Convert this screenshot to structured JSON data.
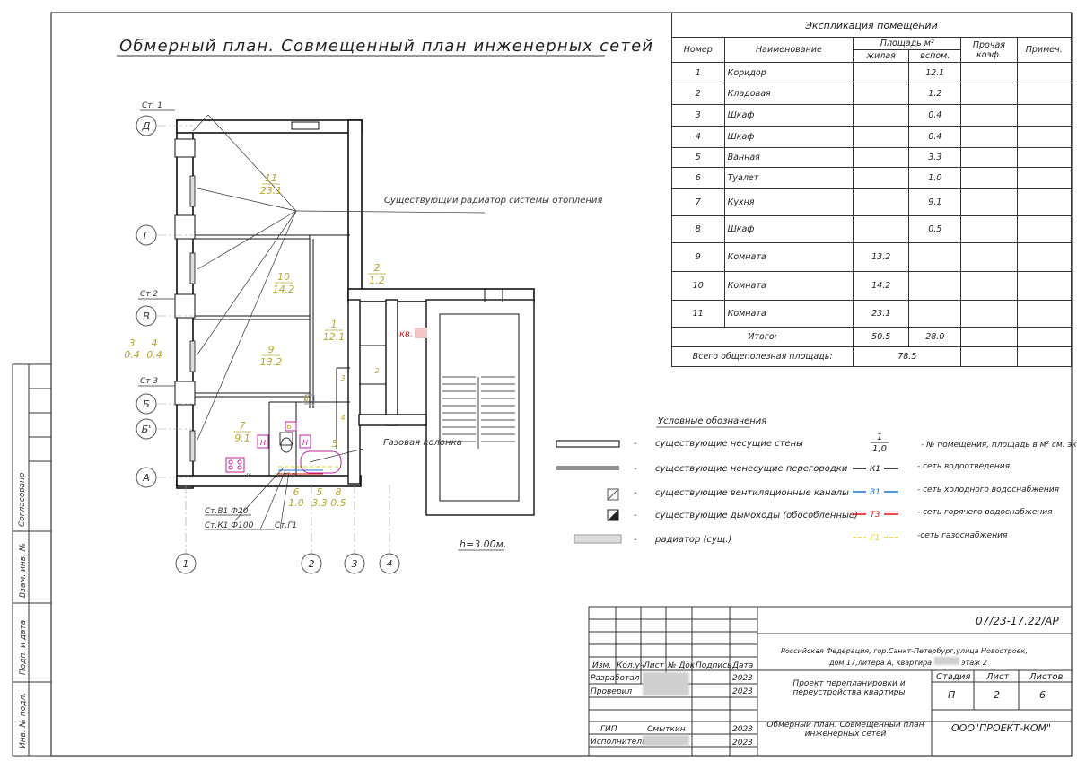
{
  "title": "Обмерный план. Совмещенный план инженерных сетей",
  "height_note": "h=3.00м.",
  "axes": {
    "letters": [
      "Д",
      "Г",
      "В",
      "Б",
      "Б'",
      "А"
    ],
    "numbers": [
      "1",
      "2",
      "3",
      "4"
    ]
  },
  "risers": [
    "Ст. 1",
    "Ст 2",
    "Ст 3"
  ],
  "riser_labels": [
    "Ст.В1 Ф20",
    "Ст.К1 Ф100",
    "Ст.Г1"
  ],
  "room_labels": [
    {
      "no": "11",
      "area": "23.1"
    },
    {
      "no": "10",
      "area": "14.2"
    },
    {
      "no": "9",
      "area": "13.2"
    },
    {
      "no": "2",
      "area": "1.2"
    },
    {
      "no": "1",
      "area": "12.1"
    },
    {
      "no": "7",
      "area": "9.1"
    },
    {
      "no": "3",
      "area": "0.4"
    },
    {
      "no": "4",
      "area": "0.4"
    },
    {
      "no": "5",
      "area": ""
    },
    {
      "no": "6",
      "area": "1.0"
    },
    {
      "no": "5",
      "area": "3.3"
    },
    {
      "no": "8",
      "area": "0.5"
    }
  ],
  "small_tags": [
    "2",
    "3",
    "4",
    "8",
    "6",
    "Н",
    "Н",
    "И",
    "К",
    "Т",
    "В"
  ],
  "annotations": {
    "radiator": "Существующий радиатор системы отопления",
    "gas_column": "Газовая колонка",
    "apartment": "кв."
  },
  "explication": {
    "title": "Экспликация помещений",
    "headers": {
      "no": "Номер",
      "name": "Наименование",
      "area": "Площадь м²",
      "living": "жилая",
      "aux": "вспом.",
      "other": "Прочая коэф.",
      "note": "Примеч."
    },
    "rows": [
      {
        "no": "1",
        "name": "Коридор",
        "living": "",
        "aux": "12.1"
      },
      {
        "no": "2",
        "name": "Кладовая",
        "living": "",
        "aux": "1.2"
      },
      {
        "no": "3",
        "name": "Шкаф",
        "living": "",
        "aux": "0.4"
      },
      {
        "no": "4",
        "name": "Шкаф",
        "living": "",
        "aux": "0.4"
      },
      {
        "no": "5",
        "name": "Ванная",
        "living": "",
        "aux": "3.3"
      },
      {
        "no": "6",
        "name": "Туалет",
        "living": "",
        "aux": "1.0"
      },
      {
        "no": "7",
        "name": "Кухня",
        "living": "",
        "aux": "9.1"
      },
      {
        "no": "8",
        "name": "Шкаф",
        "living": "",
        "aux": "0.5"
      },
      {
        "no": "9",
        "name": "Комната",
        "living": "13.2",
        "aux": ""
      },
      {
        "no": "10",
        "name": "Комната",
        "living": "14.2",
        "aux": ""
      },
      {
        "no": "11",
        "name": "Комната",
        "living": "23.1",
        "aux": ""
      }
    ],
    "total_label": "Итого:",
    "total_living": "50.5",
    "total_aux": "28.0",
    "grand_label": "Всего общеполезная площадь:",
    "grand_value": "78.5"
  },
  "legend": {
    "title": "Условные обозначения",
    "dash": "-",
    "items": [
      "существующие несущие стены",
      "существующие ненесущие перегородки",
      "существующие вентиляционные каналы",
      "существующие дымоходы (обособленные)",
      "радиатор (сущ.)"
    ],
    "room_symbol_top": "1",
    "room_symbol_bottom": "1,0",
    "room_symbol_text": "- № помещения, площадь в м² см. экспликацию",
    "networks": [
      {
        "code": "К1",
        "text": "- сеть водоотведения",
        "color": "#000000"
      },
      {
        "code": "В1",
        "text": "- сеть холодного водоснабжения",
        "color": "#1f6fd6"
      },
      {
        "code": "Т3",
        "text": "- сеть горячего водоснабжения",
        "color": "#e01010"
      },
      {
        "code": "Г1",
        "text": "-сеть газоснабжения",
        "color": "#e8d21a"
      }
    ]
  },
  "side_stamp": [
    "Согласовано",
    "Взам. инв. №",
    "Подп. и дата",
    "Инв. № подл."
  ],
  "titleblock": {
    "code": "07/23-17.22/АР",
    "address_1": "Российская Федерация, гор.Санкт-Петербург,улица Новостроек,",
    "address_2": "дом 17,литера А, квартира",
    "address_3": "этаж 2",
    "col_heads": [
      "Изм.",
      "Кол.уч",
      "Лист",
      "№ Док",
      "Подпись",
      "Дата"
    ],
    "rows": [
      {
        "role": "Разработал",
        "name": "",
        "date": "2023"
      },
      {
        "role": "Проверил",
        "name": "",
        "date": "2023"
      },
      {
        "role": "ГИП",
        "name": "Смыткин",
        "date": "2023"
      },
      {
        "role": "Исполнитель",
        "name": "",
        "date": "2023"
      }
    ],
    "project": "Проект перепланировки и переустройства квартиры",
    "stage_head": "Стадия",
    "sheet_head": "Лист",
    "sheets_head": "Листов",
    "stage": "П",
    "sheet": "2",
    "sheets": "6",
    "drawing": "Обмерный план. Совмещенный план инженерных сетей",
    "company": "ООО\"ПРОЕКТ-КОМ\""
  }
}
